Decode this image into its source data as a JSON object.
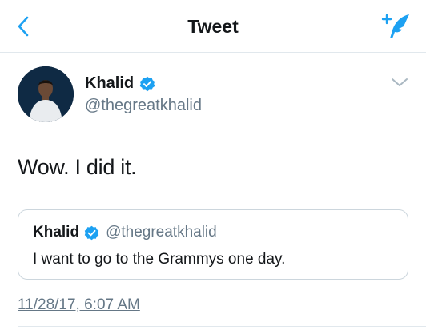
{
  "header": {
    "title": "Tweet",
    "back_icon": "chevron-left-icon",
    "compose_icon": "compose-tweet-icon"
  },
  "tweet": {
    "author_name": "Khalid",
    "author_handle": "@thegreatkhalid",
    "verified": true,
    "text": "Wow. I did it.",
    "timestamp": "11/28/17, 6:07 AM",
    "more_icon": "chevron-down-icon"
  },
  "quoted_tweet": {
    "author_name": "Khalid",
    "author_handle": "@thegreatkhalid",
    "verified": true,
    "text": "I want to go to the Grammys one day."
  },
  "colors": {
    "accent": "#1da1f2",
    "text_primary": "#14171a",
    "text_secondary": "#657786",
    "border": "#ccd6dd"
  }
}
